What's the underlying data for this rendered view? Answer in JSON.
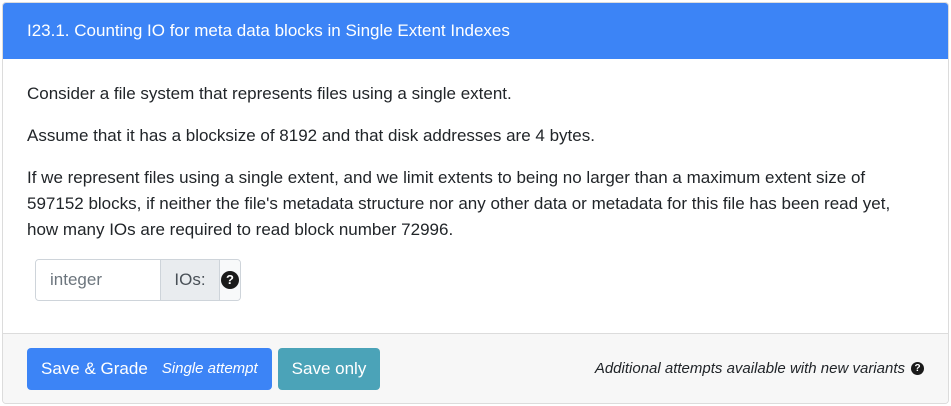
{
  "question": {
    "title": "I23.1. Counting IO for meta data blocks in Single Extent Indexes",
    "paragraphs": [
      "Consider a file system that represents files using a single extent.",
      "Assume that it has a blocksize of 8192 and that disk addresses are 4 bytes.",
      "If we represent files using a single extent, and we limit extents to being no larger than a maximum extent size of 597152 blocks, if neither the file's metadata structure nor any other data or metadata for this file has been read yet, how many IOs are required to read block number 72996."
    ]
  },
  "answer": {
    "placeholder": "integer",
    "value": "",
    "unit": "IOs:",
    "help_icon": "question-circle-icon"
  },
  "footer": {
    "save_grade_label": "Save & Grade",
    "save_grade_sub": "Single attempt",
    "save_only_label": "Save only",
    "note": "Additional attempts available with new variants",
    "note_icon": "question-circle-icon"
  },
  "colors": {
    "header": "#3c84f6",
    "primary": "#3c84f6",
    "info": "#4ba3b8"
  }
}
